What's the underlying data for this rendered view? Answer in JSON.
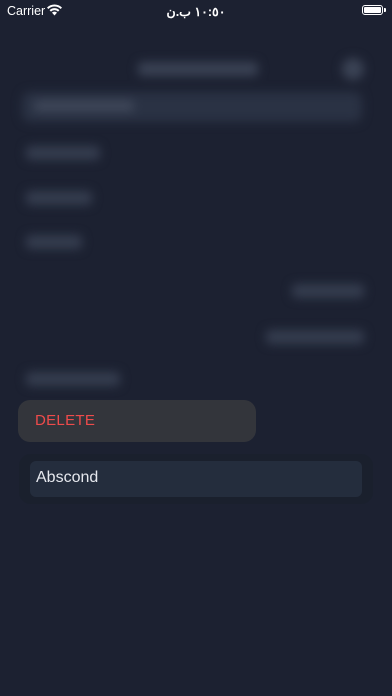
{
  "status_bar": {
    "carrier": "Carrier",
    "time": "١٠:٥٠ ب.ن"
  },
  "action_sheet": {
    "delete_label": "DELETE",
    "cancel_label": "Abscond"
  },
  "colors": {
    "background": "#1c2131",
    "destructive": "#ef4b4b",
    "action_group_bg": "#33353b",
    "cancel_button_bg": "#242d3d"
  }
}
